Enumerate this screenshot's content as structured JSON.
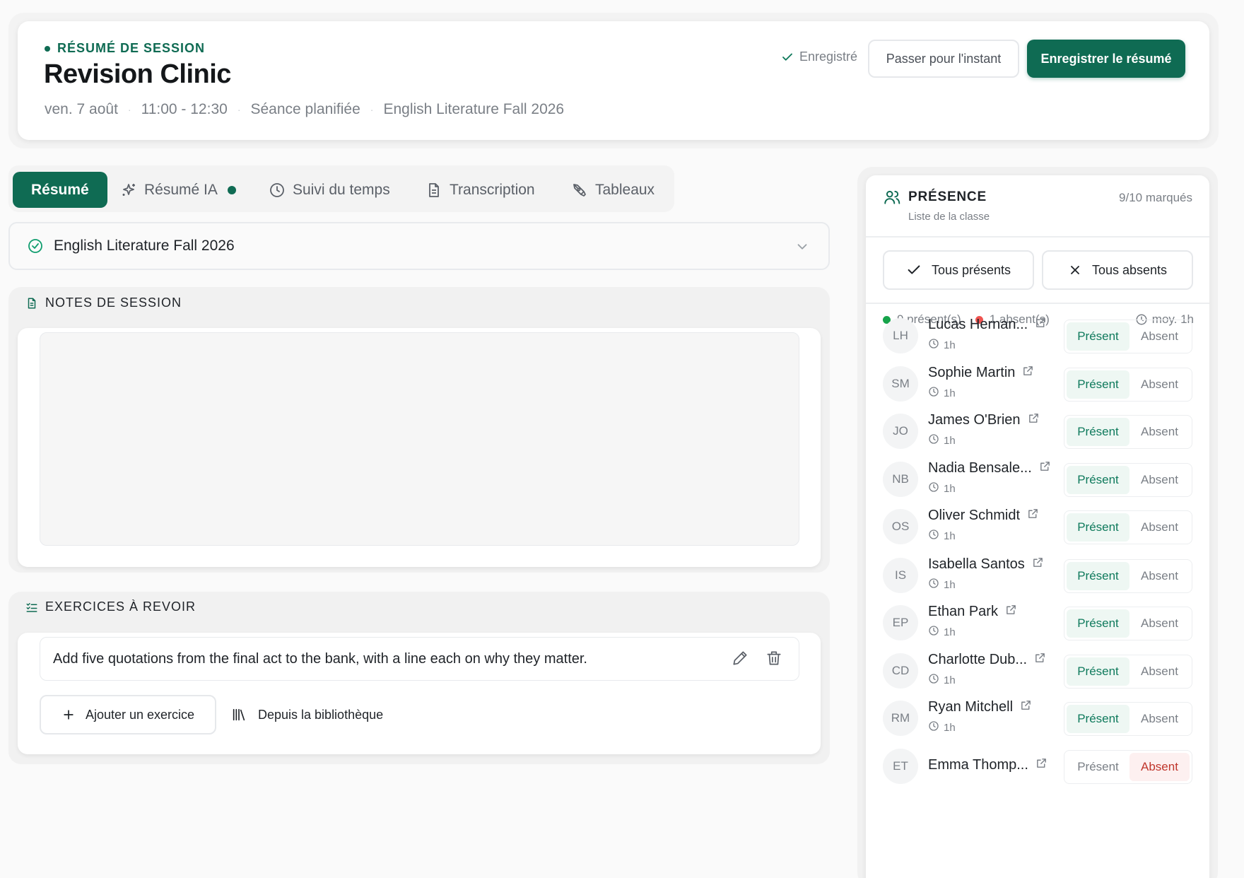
{
  "header": {
    "eyebrow": "RÉSUMÉ DE SESSION",
    "title": "Revision Clinic",
    "date": "ven. 7 août",
    "time": "11:00 - 12:30",
    "status": "Séance planifiée",
    "course": "English Literature Fall 2026",
    "saved_label": "Enregistré",
    "skip_label": "Passer pour l'instant",
    "save_label": "Enregistrer le résumé"
  },
  "tabs": [
    {
      "label": "Résumé",
      "icon": "none",
      "active": true
    },
    {
      "label": "Résumé IA",
      "icon": "sparkles-icon",
      "active": false
    },
    {
      "label": "Suivi du temps",
      "icon": "clock-icon",
      "active": false
    },
    {
      "label": "Transcription",
      "icon": "document-icon",
      "active": false
    },
    {
      "label": "Tableaux",
      "icon": "pen-tool-icon",
      "active": false
    }
  ],
  "course_select": {
    "value": "English Literature Fall 2026"
  },
  "notes": {
    "title": "NOTES DE SESSION",
    "value": ""
  },
  "exercises": {
    "title": "EXERCICES À REVOIR",
    "items": [
      "Add five quotations from the final act to the bank, with a line each on why they matter."
    ],
    "add_label": "Ajouter un exercice",
    "library_label": "Depuis la bibliothèque"
  },
  "attendance": {
    "title": "PRÉSENCE",
    "subtitle": "Liste de la classe",
    "count": "9/10 marqués",
    "all_present_label": "Tous présents",
    "all_absent_label": "Tous absents",
    "present_stat": "9 présent(s)",
    "absent_stat": "1 absent(s)",
    "avg_stat": "moy. 1h",
    "present_label": "Présent",
    "absent_label": "Absent",
    "students": [
      {
        "initials": "LH",
        "name": "Lucas Hernan...",
        "hours": "1h",
        "status": "present"
      },
      {
        "initials": "SM",
        "name": "Sophie Martin",
        "hours": "1h",
        "status": "present"
      },
      {
        "initials": "JO",
        "name": "James O'Brien",
        "hours": "1h",
        "status": "present"
      },
      {
        "initials": "NB",
        "name": "Nadia Bensale...",
        "hours": "1h",
        "status": "present"
      },
      {
        "initials": "OS",
        "name": "Oliver Schmidt",
        "hours": "1h",
        "status": "present"
      },
      {
        "initials": "IS",
        "name": "Isabella Santos",
        "hours": "1h",
        "status": "present"
      },
      {
        "initials": "EP",
        "name": "Ethan Park",
        "hours": "1h",
        "status": "present"
      },
      {
        "initials": "CD",
        "name": "Charlotte Dub...",
        "hours": "1h",
        "status": "present"
      },
      {
        "initials": "RM",
        "name": "Ryan Mitchell",
        "hours": "1h",
        "status": "present"
      },
      {
        "initials": "ET",
        "name": "Emma Thomp...",
        "hours": "",
        "status": "absent"
      }
    ]
  },
  "colors": {
    "accent": "#0f6b53",
    "present": "#0f7a5c",
    "absent": "#c0362c",
    "absent_dot": "#ef5350",
    "present_dot": "#16a34a"
  }
}
